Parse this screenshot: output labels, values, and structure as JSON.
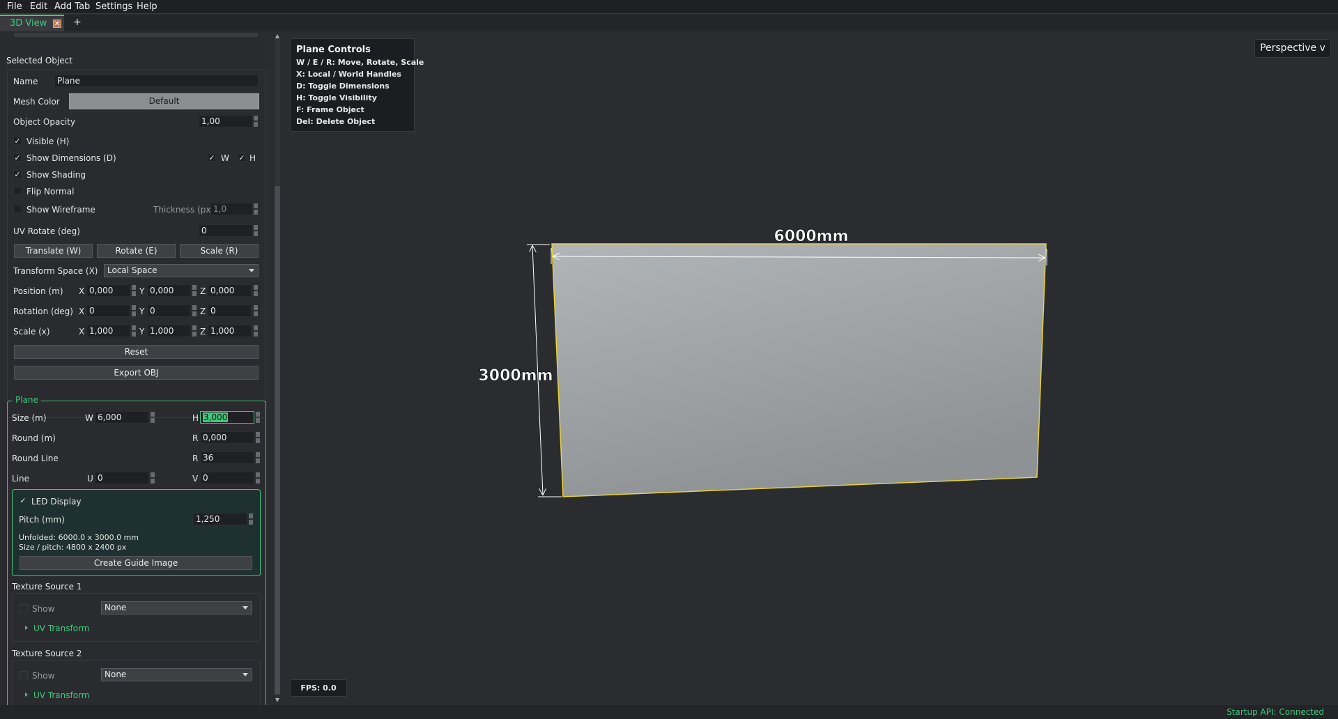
{
  "menu": {
    "file": "File",
    "edit": "Edit",
    "add_tab": "Add Tab",
    "settings": "Settings",
    "help": "Help"
  },
  "tabs": {
    "active": "3D View",
    "close": "✕",
    "add": "+"
  },
  "selected_object": {
    "section_title": "Selected Object",
    "name_label": "Name",
    "name_value": "Plane",
    "mesh_color_label": "Mesh Color",
    "mesh_color_button": "Default",
    "opacity_label": "Object Opacity",
    "opacity_value": "1,00",
    "visible_label": "Visible (H)",
    "show_dimensions_label": "Show Dimensions (D)",
    "dim_w": "W",
    "dim_h": "H",
    "show_shading_label": "Show Shading",
    "flip_normal_label": "Flip Normal",
    "show_wireframe_label": "Show Wireframe",
    "thickness_label": "Thickness (px)",
    "thickness_value": "1,0",
    "uv_rotate_label": "UV Rotate (deg)",
    "uv_rotate_value": "0",
    "translate_button": "Translate (W)",
    "rotate_button": "Rotate (E)",
    "scale_button": "Scale (R)",
    "transform_space_label": "Transform Space (X)",
    "transform_space_value": "Local Space",
    "position_label": "Position (m)",
    "rotation_label": "Rotation (deg)",
    "scale_label": "Scale (x)",
    "axis_x": "X",
    "axis_y": "Y",
    "axis_z": "Z",
    "position": {
      "x": "0,000",
      "y": "0,000",
      "z": "0,000"
    },
    "rotation": {
      "x": "0",
      "y": "0",
      "z": "0"
    },
    "scale": {
      "x": "1,000",
      "y": "1,000",
      "z": "1,000"
    },
    "reset_button": "Reset",
    "export_button": "Export OBJ"
  },
  "plane": {
    "section_title": "Plane",
    "size_label": "Size (m)",
    "w_label": "W",
    "w_value": "6,000",
    "h_label": "H",
    "h_value": "3,000",
    "round_label": "Round (m)",
    "round_r_label": "R",
    "round_value": "0,000",
    "round_line_label": "Round Line",
    "round_line_r_label": "R",
    "round_line_value": "36",
    "line_label": "Line",
    "u_label": "U",
    "u_value": "0",
    "v_label": "V",
    "v_value": "0",
    "led_display_label": "LED Display",
    "pitch_label": "Pitch (mm)",
    "pitch_value": "1,250",
    "unfolded_text": "Unfolded: 6000.0 x 3000.0 mm",
    "size_pitch_text": "Size / pitch: 4800 x 2400 px",
    "guide_button": "Create Guide Image"
  },
  "texture1": {
    "title": "Texture Source 1",
    "show_label": "Show",
    "source_value": "None",
    "uv_transform": "UV Transform"
  },
  "texture2": {
    "title": "Texture Source 2",
    "show_label": "Show",
    "source_value": "None",
    "uv_transform": "UV Transform"
  },
  "viewport": {
    "controls_title": "Plane Controls",
    "controls_lines": [
      "W / E / R: Move, Rotate, Scale",
      "X: Local / World Handles",
      "D: Toggle Dimensions",
      "H: Toggle Visibility",
      "F: Frame Object",
      "Del: Delete Object"
    ],
    "perspective_button": "Perspective v",
    "width_dimension": "6000mm",
    "height_dimension": "3000mm",
    "fps": "FPS: 0.0"
  },
  "status": {
    "text": "Startup API: Connected"
  },
  "colors": {
    "accent": "#3ec97a",
    "plane_outline": "#e6d23a",
    "background": "#2b2c30"
  }
}
